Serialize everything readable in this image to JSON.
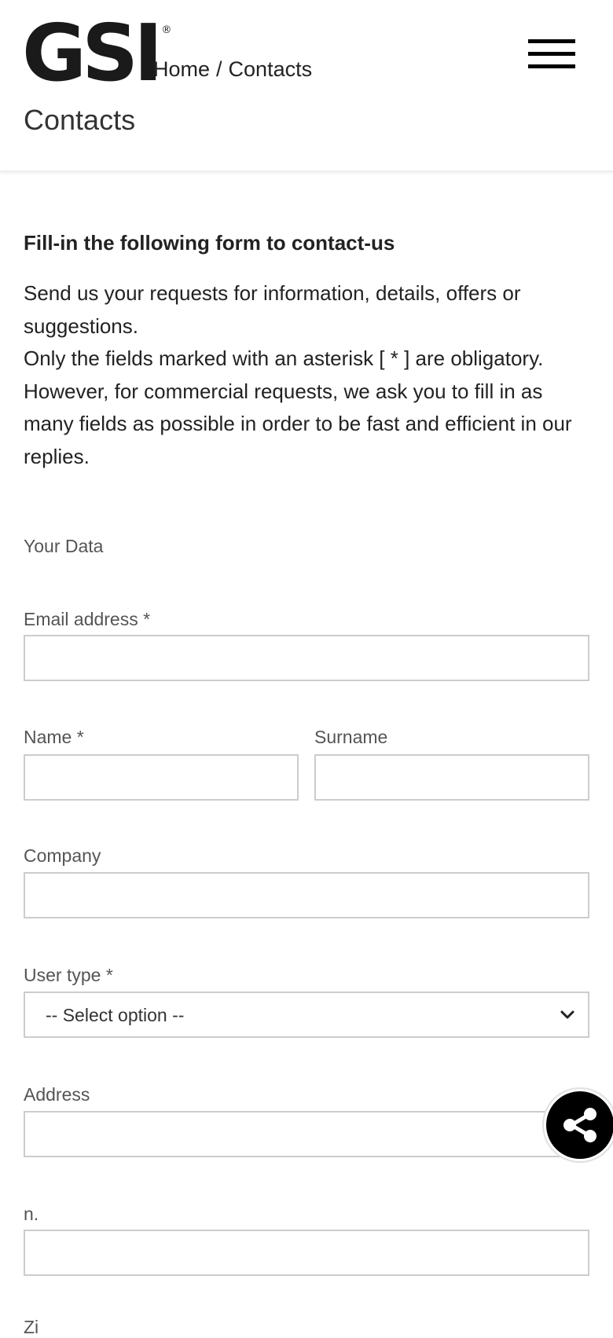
{
  "header": {
    "logo_text": "GSI",
    "logo_reg": "®",
    "breadcrumb": {
      "home": "Home",
      "separator": "/",
      "current": "Contacts"
    },
    "page_title": "Contacts",
    "menu_icon": "hamburger-icon"
  },
  "intro": {
    "heading": "Fill-in the following form to contact-us",
    "paragraph_1": "Send us your requests for information, details, offers or suggestions.",
    "paragraph_2": "Only the fields marked with an asterisk [ * ] are obligatory.",
    "paragraph_3": "However, for commercial requests, we ask you to fill in as many fields as possible in order to be fast and efficient in our replies."
  },
  "form": {
    "section_label": "Your Data",
    "email_label": "Email address *",
    "email_value": "",
    "name_label": "Name *",
    "name_value": "",
    "surname_label": "Surname",
    "surname_value": "",
    "company_label": "Company",
    "company_value": "",
    "user_type_label": "User type *",
    "user_type_selected": "-- Select option --",
    "address_label": "Address",
    "address_value": "",
    "number_label": "n.",
    "number_value": "",
    "next_label_partial": "Zi"
  },
  "share": {
    "icon": "share-icon",
    "bg_color": "#000000",
    "icon_color": "#ffffff"
  }
}
